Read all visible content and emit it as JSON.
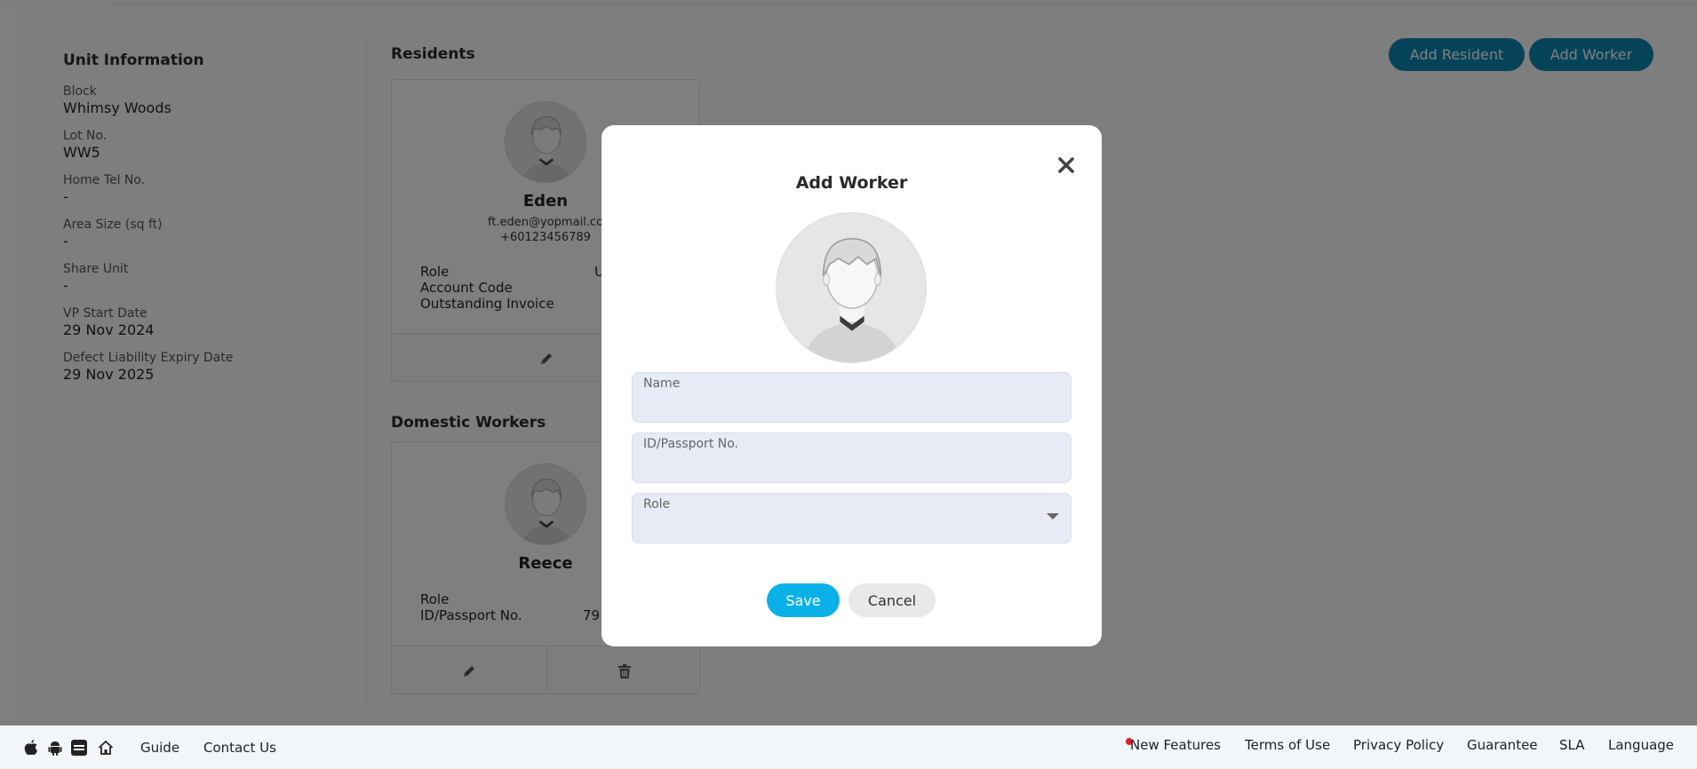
{
  "unit_info": {
    "title": "Unit Information",
    "fields": [
      {
        "label": "Block",
        "value": "Whimsy Woods"
      },
      {
        "label": "Lot No.",
        "value": "WW5"
      },
      {
        "label": "Home Tel No.",
        "value": "-"
      },
      {
        "label": "Area Size (sq ft)",
        "value": "-"
      },
      {
        "label": "Share Unit",
        "value": "-"
      },
      {
        "label": "VP Start Date",
        "value": "29 Nov 2024"
      },
      {
        "label": "Defect Liability Expiry Date",
        "value": "29 Nov 2025"
      }
    ]
  },
  "residents": {
    "title": "Residents",
    "card": {
      "name": "Eden",
      "email": "ft.eden@yopmail.co",
      "phone": "+60123456789",
      "role_label": "Role",
      "role_value": "U",
      "account_code_label": "Account Code",
      "outstanding_invoice_label": "Outstanding Invoice"
    }
  },
  "domestic_workers": {
    "title": "Domestic Workers",
    "card": {
      "name": "Reece",
      "role_label": "Role",
      "id_label": "ID/Passport No.",
      "id_value": "79"
    }
  },
  "top_buttons": {
    "add_resident": "Add Resident",
    "add_worker": "Add Worker"
  },
  "modal": {
    "title": "Add Worker",
    "name_label": "Name",
    "id_label": "ID/Passport No.",
    "role_label": "Role",
    "save": "Save",
    "cancel": "Cancel"
  },
  "footer": {
    "left_links": [
      "Guide",
      "Contact Us"
    ],
    "right_links": [
      "New Features",
      "Terms of Use",
      "Privacy Policy",
      "Guarantee",
      "SLA",
      "Language"
    ],
    "icons": [
      "apple-icon",
      "android-icon",
      "app-icon",
      "home-icon"
    ]
  },
  "colors": {
    "accent": "#0ab1e8",
    "top_button": "#0a88b0",
    "input_bg": "#e6ebf5",
    "footer_bg": "#f1f6fb",
    "notification_dot": "#e02020"
  }
}
